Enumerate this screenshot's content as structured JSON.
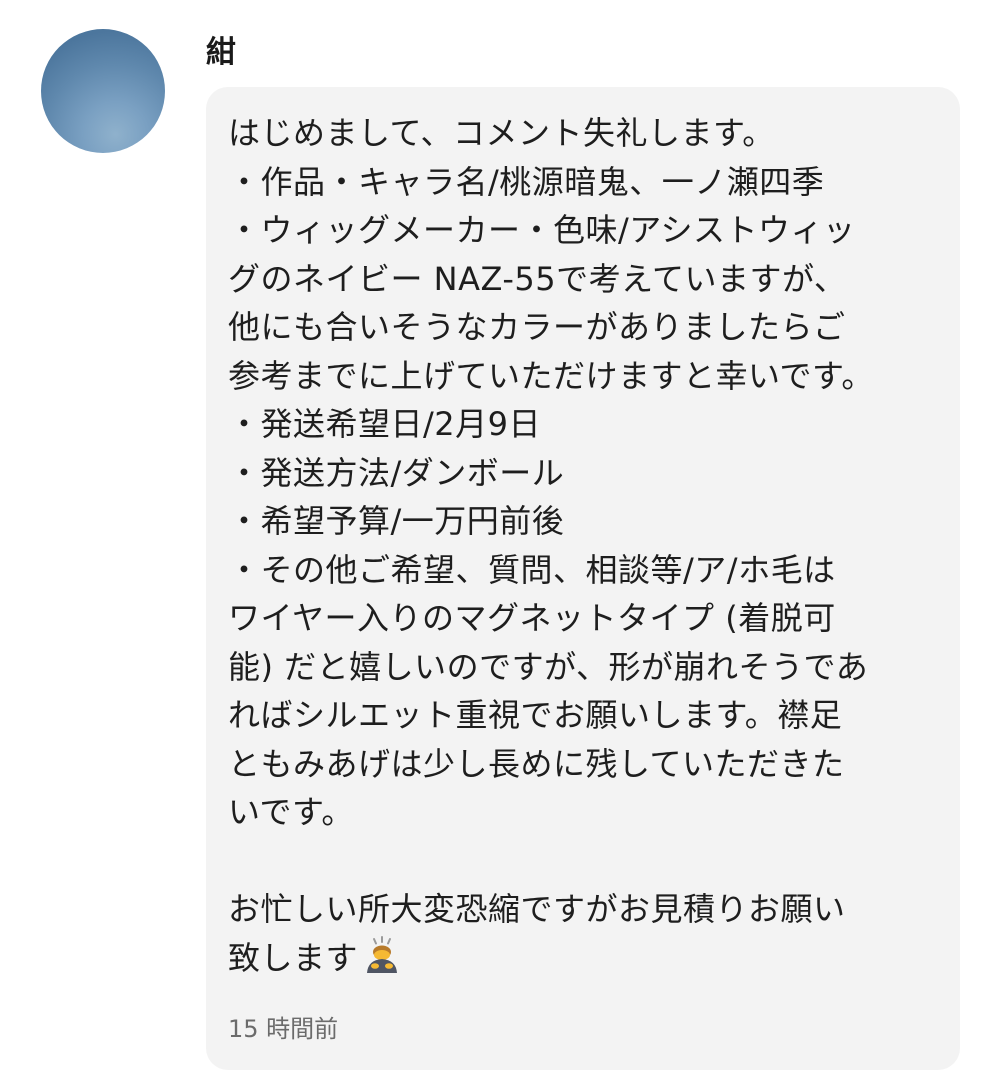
{
  "comment": {
    "username": "紺",
    "lines": [
      "はじめまして、コメント失礼します。",
      "・作品・キャラ名/桃源暗鬼、一ノ瀬四季",
      "・ウィッグメーカー・色味/アシストウィッ",
      "グのネイビー NAZ-55で考えていますが、",
      "他にも合いそうなカラーがありましたらご",
      "参考までに上げていただけますと幸いです。",
      "・発送希望日/2月9日",
      "・発送方法/ダンボール",
      "・希望予算/一万円前後",
      "・その他ご希望、質問、相談等/ア/ホ毛は",
      "ワイヤー入りのマグネットタイプ (着脱可",
      "能) だと嬉しいのですが、形が崩れそうであ",
      "ればシルエット重視でお願いします。襟足",
      "ともみあげは少し長めに残していただきた",
      "いです。",
      "",
      "お忙しい所大変恐縮ですがお見積りお願い",
      "致します"
    ],
    "emoji": "person-bowing-icon",
    "timestamp": "15 時間前"
  },
  "colors": {
    "bubble_background": "#f3f3f3",
    "avatar_blue": "#5f88ad",
    "timestamp_gray": "#6b6b6b"
  }
}
